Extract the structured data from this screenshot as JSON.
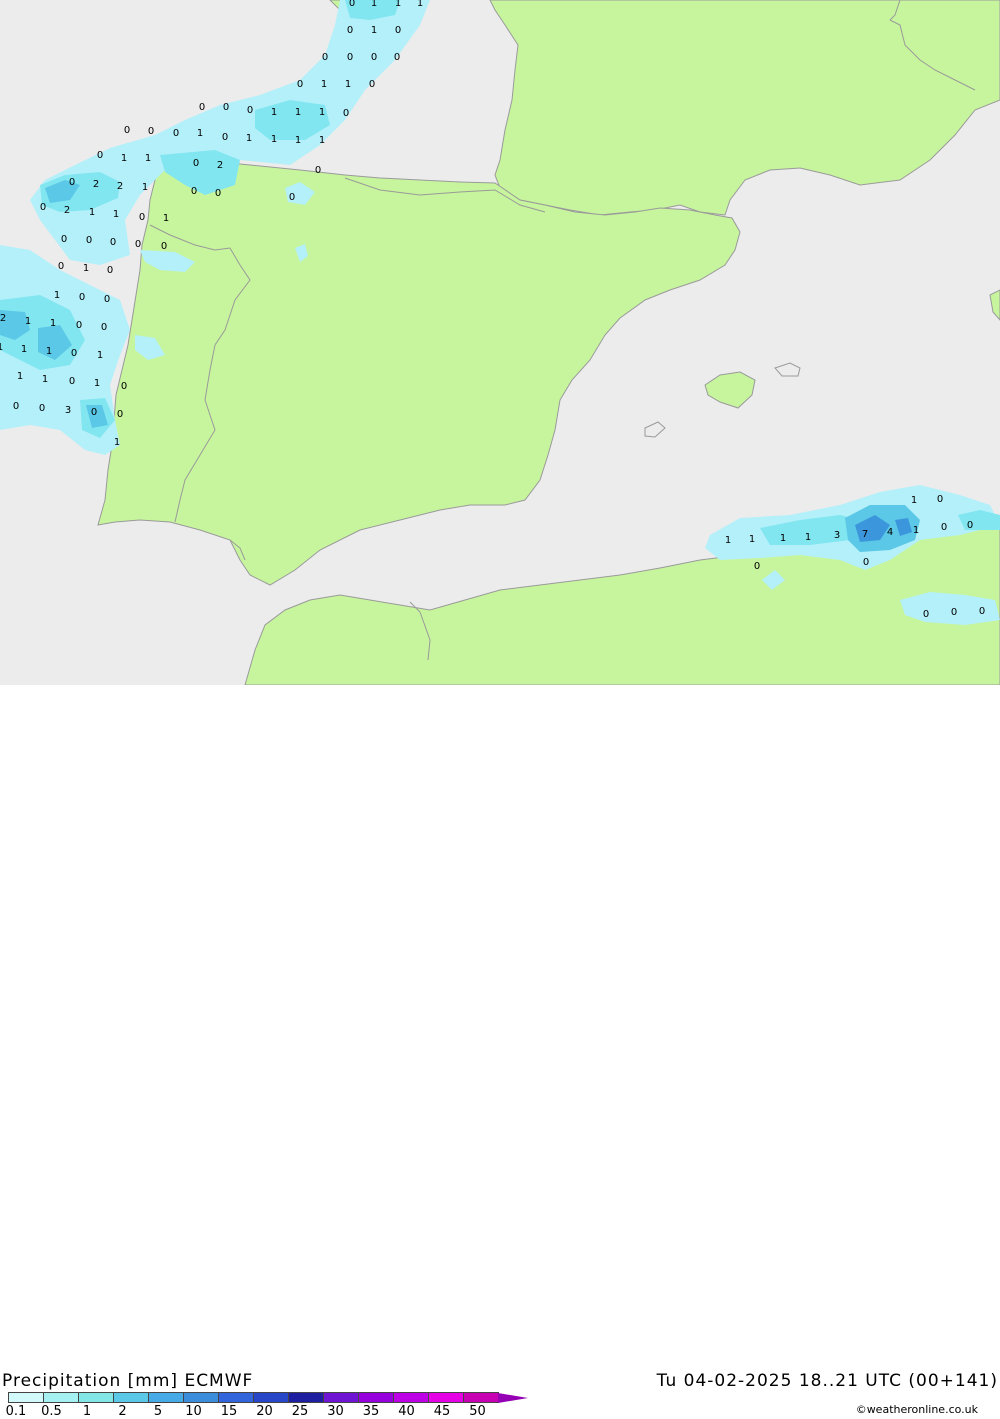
{
  "colors": {
    "sea": "#ececec",
    "land": "#c7f59d",
    "border": "#9a9a9a",
    "precip_light": "#b4f0fa",
    "precip_mid": "#82e6f0",
    "precip_heavy": "#5ac8e6",
    "precip_very_heavy": "#3c96dc"
  },
  "header": {
    "title": "Precipitation [mm] ECMWF",
    "valid_time": "Tu 04-02-2025 18..21 UTC (00+141)",
    "credit": "©weatheronline.co.uk"
  },
  "legend": {
    "scale": [
      {
        "label": "0.1",
        "color": "#d2fafa"
      },
      {
        "label": "0.5",
        "color": "#a5f0f0"
      },
      {
        "label": "1",
        "color": "#82e6e6"
      },
      {
        "label": "2",
        "color": "#5ac8e6"
      },
      {
        "label": "5",
        "color": "#46aae6"
      },
      {
        "label": "10",
        "color": "#3c8cdc"
      },
      {
        "label": "15",
        "color": "#3264dc"
      },
      {
        "label": "20",
        "color": "#2846c8"
      },
      {
        "label": "25",
        "color": "#1e1ea0"
      },
      {
        "label": "30",
        "color": "#6e14d2"
      },
      {
        "label": "35",
        "color": "#9600dc"
      },
      {
        "label": "40",
        "color": "#be00e6"
      },
      {
        "label": "45",
        "color": "#e600e6"
      },
      {
        "label": "50",
        "color": "#c800b4"
      }
    ],
    "arrow_color": "#9600b4"
  },
  "map_values": [
    "0",
    "1",
    "1",
    "1",
    "0",
    "1",
    "0",
    "0",
    "0",
    "0",
    "0",
    "0",
    "1",
    "1",
    "0",
    "0",
    "0",
    "0",
    "1",
    "1",
    "1",
    "0",
    "0",
    "0",
    "0",
    "1",
    "0",
    "1",
    "1",
    "1",
    "1",
    "0",
    "0",
    "1",
    "1",
    "0",
    "2",
    "0",
    "2",
    "2",
    "1",
    "0",
    "0",
    "0",
    "2",
    "1",
    "1",
    "0",
    "0",
    "1",
    "0",
    "0",
    "0",
    "0",
    "0",
    "0",
    "1",
    "0",
    "1",
    "0",
    "0",
    "2",
    "1",
    "1",
    "0",
    "0",
    "1",
    "1",
    "1",
    "0",
    "1",
    "1",
    "1",
    "0",
    "1",
    "0",
    "0",
    "0",
    "3",
    "0",
    "0",
    "1",
    "0",
    "1",
    "1",
    "1",
    "1",
    "3",
    "7",
    "4",
    "1",
    "0",
    "0",
    "1",
    "0",
    "0",
    "0",
    "0",
    "0"
  ]
}
